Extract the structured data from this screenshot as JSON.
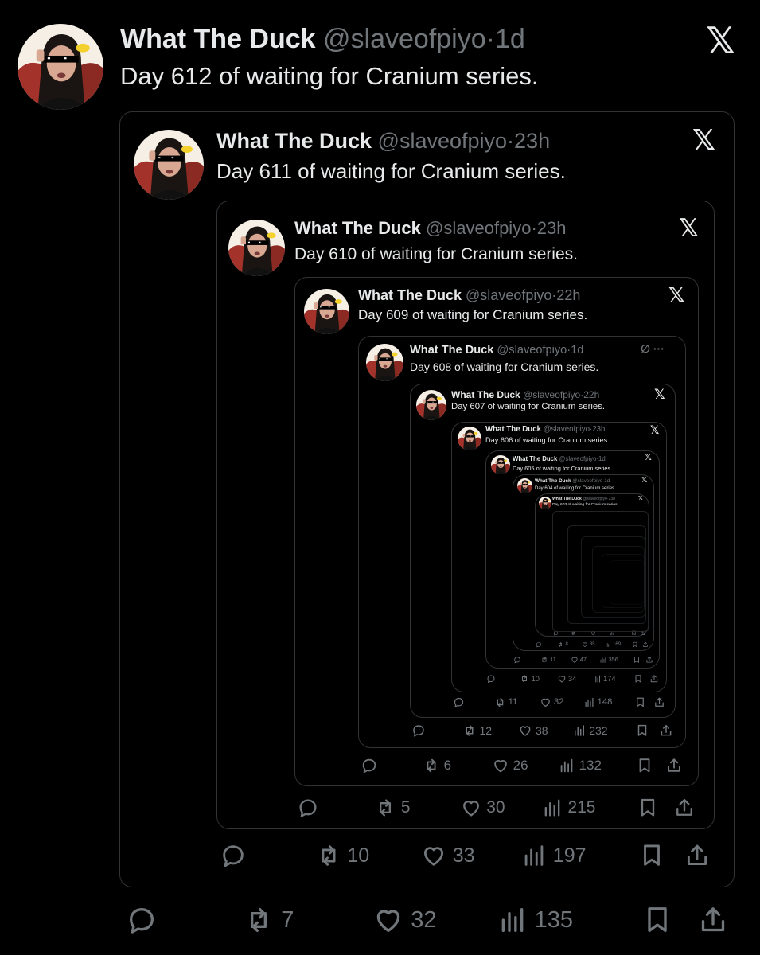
{
  "colors": {
    "background": "#000000",
    "text": "#e7e9ea",
    "muted": "#71767b",
    "border": "#2f3336"
  },
  "tweets": [
    {
      "name": "What The Duck",
      "handle": "@slaveofpiyo",
      "time": "1d",
      "text": "Day 612 of waiting for Cranium series.",
      "replies": "",
      "reposts": "7",
      "likes": "32",
      "views": "135",
      "corner_icon": "x-logo-icon"
    },
    {
      "name": "What The Duck",
      "handle": "@slaveofpiyo",
      "time": "23h",
      "text": "Day 611 of waiting for Cranium series.",
      "replies": "",
      "reposts": "10",
      "likes": "33",
      "views": "197",
      "corner_icon": "x-logo-icon"
    },
    {
      "name": "What The Duck",
      "handle": "@slaveofpiyo",
      "time": "23h",
      "text": "Day 610 of waiting for Cranium series.",
      "replies": "",
      "reposts": "5",
      "likes": "30",
      "views": "215",
      "corner_icon": "x-logo-icon"
    },
    {
      "name": "What The Duck",
      "handle": "@slaveofpiyo",
      "time": "22h",
      "text": "Day 609 of waiting for Cranium series.",
      "replies": "",
      "reposts": "6",
      "likes": "26",
      "views": "132",
      "corner_icon": "x-logo-icon"
    },
    {
      "name": "What The Duck",
      "handle": "@slaveofpiyo",
      "time": "1d",
      "text": "Day 608 of waiting for Cranium series.",
      "replies": "",
      "reposts": "12",
      "likes": "38",
      "views": "232",
      "corner_icon": "grok-and-more-icons"
    },
    {
      "name": "What The Duck",
      "handle": "@slaveofpiyo",
      "time": "22h",
      "text": "Day 607 of waiting for Cranium series.",
      "replies": "",
      "reposts": "11",
      "likes": "32",
      "views": "148",
      "corner_icon": "x-logo-icon"
    },
    {
      "name": "What The Duck",
      "handle": "@slaveofpiyo",
      "time": "23h",
      "text": "Day 606 of waiting for Cranium series.",
      "replies": "",
      "reposts": "10",
      "likes": "34",
      "views": "174",
      "corner_icon": "x-logo-icon"
    },
    {
      "name": "What The Duck",
      "handle": "@slaveofpiyo",
      "time": "1d",
      "text": "Day 605 of waiting for Cranium series.",
      "replies": "",
      "reposts": "11",
      "likes": "47",
      "views": "356",
      "corner_icon": "x-logo-icon"
    },
    {
      "name": "What The Duck",
      "handle": "@slaveofpiyo",
      "time": "1d",
      "text": "Day 604 of waiting for Cranium series.",
      "replies": "",
      "reposts": "8",
      "likes": "35",
      "views": "169",
      "corner_icon": "x-logo-icon"
    },
    {
      "name": "What The Duck",
      "handle": "@slaveofpiyo",
      "time": "23h",
      "text": "Day 603 of waiting for Cranium series.",
      "replies": "",
      "reposts": "",
      "likes": "",
      "views": "",
      "corner_icon": "x-logo-icon"
    }
  ]
}
